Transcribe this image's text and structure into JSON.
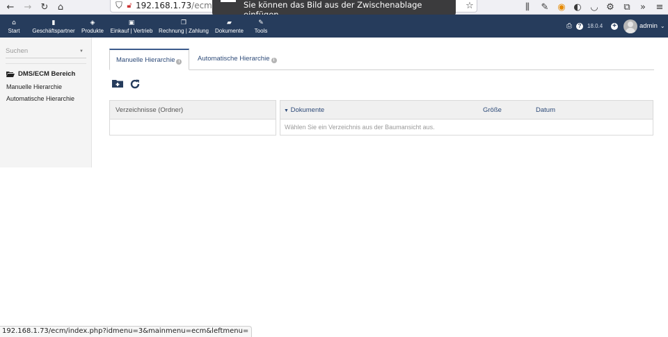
{
  "browser": {
    "url_host": "192.168.1.73",
    "url_path": "/ecm/index",
    "toast_text": "Sie können das Bild aus der Zwischenablage einfügen.",
    "status_url": "192.168.1.73/ecm/index.php?idmenu=3&mainmenu=ecm&leftmenu="
  },
  "topnav": {
    "items": [
      {
        "label": "Start",
        "icon": "home-icon"
      },
      {
        "label": "Geschäftspartner",
        "icon": "building-icon"
      },
      {
        "label": "Produkte",
        "icon": "cube-icon"
      },
      {
        "label": "Einkauf | Vertrieb",
        "icon": "briefcase-icon"
      },
      {
        "label": "Rechnung | Zahlung",
        "icon": "bills-icon"
      },
      {
        "label": "Dokumente",
        "icon": "folder-open-icon"
      },
      {
        "label": "Tools",
        "icon": "wrench-icon"
      }
    ],
    "version": "18.0.4",
    "user": "admin"
  },
  "sidebar": {
    "search_placeholder": "Suchen",
    "section_title": "DMS/ECM Bereich",
    "links": [
      "Manuelle Hierarchie",
      "Automatische Hierarchie"
    ]
  },
  "tabs": [
    {
      "label": "Manuelle Hierarchie",
      "active": true
    },
    {
      "label": "Automatische Hierarchie",
      "active": false
    }
  ],
  "left_panel": {
    "header": "Verzeichnisse (Ordner)"
  },
  "right_panel": {
    "columns": [
      "Dokumente",
      "Größe",
      "Datum"
    ],
    "empty_message": "Wählen Sie ein Verzeichnis aus der Baumansicht aus."
  },
  "colors": {
    "nav_bg": "#263c5c",
    "link": "#2d4a78"
  }
}
